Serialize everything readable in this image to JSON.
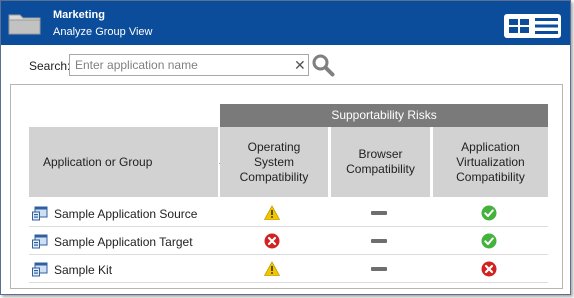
{
  "header": {
    "title": "Marketing",
    "subtitle": "Analyze Group View",
    "icons": [
      "folder-icon",
      "grid-view-icon",
      "list-view-icon"
    ]
  },
  "search": {
    "label": "Search:",
    "placeholder": "Enter application name",
    "value": ""
  },
  "table": {
    "group_header": "Supportability Risks",
    "columns": [
      "Application or Group",
      "Operating System Compatibility",
      "Browser Compatibility",
      "Application Virtualization Compatibility"
    ],
    "sort": {
      "column": "Application or Group",
      "direction": "ascending"
    },
    "rows": [
      {
        "name": "Sample Application Source",
        "os": "warning",
        "browser": "not-applicable",
        "virtualization": "compatible"
      },
      {
        "name": "Sample Application Target",
        "os": "incompatible",
        "browser": "not-applicable",
        "virtualization": "compatible"
      },
      {
        "name": "Sample Kit",
        "os": "warning",
        "browser": "not-applicable",
        "virtualization": "incompatible"
      }
    ]
  },
  "colors": {
    "title_bar": "#0b4d9b",
    "group_header": "#7a7a7a",
    "column_header": "#d2d2d2",
    "warning": "#f2c500",
    "incompatible": "#d32222",
    "compatible": "#44b23c"
  }
}
